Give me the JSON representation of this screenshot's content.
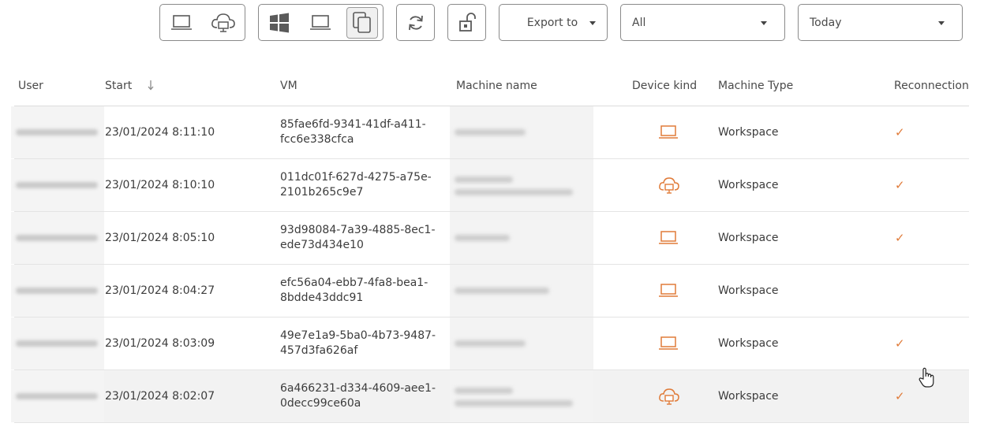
{
  "toolbar": {
    "device_filter": [
      {
        "name": "laptop",
        "icon": "laptop-icon"
      },
      {
        "name": "cloud",
        "icon": "cloud-desktop-icon"
      }
    ],
    "os_filter": [
      {
        "name": "windows",
        "icon": "windows-icon"
      },
      {
        "name": "laptop",
        "icon": "laptop-icon"
      },
      {
        "name": "copy",
        "icon": "copy-icon",
        "selected": true
      }
    ],
    "refresh_icon": "refresh-icon",
    "unlock_icon": "unlock-icon",
    "export_label": "Export to",
    "filter_value": "All",
    "period_value": "Today"
  },
  "table": {
    "columns": [
      "User",
      "Start",
      "VM",
      "Machine name",
      "Device kind",
      "Machine Type",
      "Reconnection"
    ],
    "sort_column": "Start",
    "sort_direction": "descending",
    "rows": [
      {
        "start": "23/01/2024 8:11:10",
        "vm_line1": "85fae6fd-9341-41df-a411-",
        "vm_line2": "fcc6e338cfca",
        "device": "laptop",
        "machine_type": "Workspace",
        "reconnection": "✓"
      },
      {
        "start": "23/01/2024 8:10:10",
        "vm_line1": "011dc01f-627d-4275-a75e-",
        "vm_line2": "2101b265c9e7",
        "device": "cloud",
        "machine_type": "Workspace",
        "reconnection": "✓"
      },
      {
        "start": "23/01/2024 8:05:10",
        "vm_line1": "93d98084-7a39-4885-8ec1-",
        "vm_line2": "ede73d434e10",
        "device": "laptop",
        "machine_type": "Workspace",
        "reconnection": "✓"
      },
      {
        "start": "23/01/2024 8:04:27",
        "vm_line1": "efc56a04-ebb7-4fa8-bea1-",
        "vm_line2": "8bdde43ddc91",
        "device": "laptop",
        "machine_type": "Workspace",
        "reconnection": ""
      },
      {
        "start": "23/01/2024 8:03:09",
        "vm_line1": "49e7e1a9-5ba0-4b73-9487-",
        "vm_line2": "457d3fa626af",
        "device": "laptop",
        "machine_type": "Workspace",
        "reconnection": "✓"
      },
      {
        "start": "23/01/2024 8:02:07",
        "vm_line1": "6a466231-d334-4609-aee1-",
        "vm_line2": "0decc99ce60a",
        "device": "cloud",
        "machine_type": "Workspace",
        "reconnection": "✓"
      }
    ]
  },
  "colors": {
    "accent": "#e07b39",
    "border": "#8a8a8a",
    "row_hover": "#f2f2f2"
  }
}
